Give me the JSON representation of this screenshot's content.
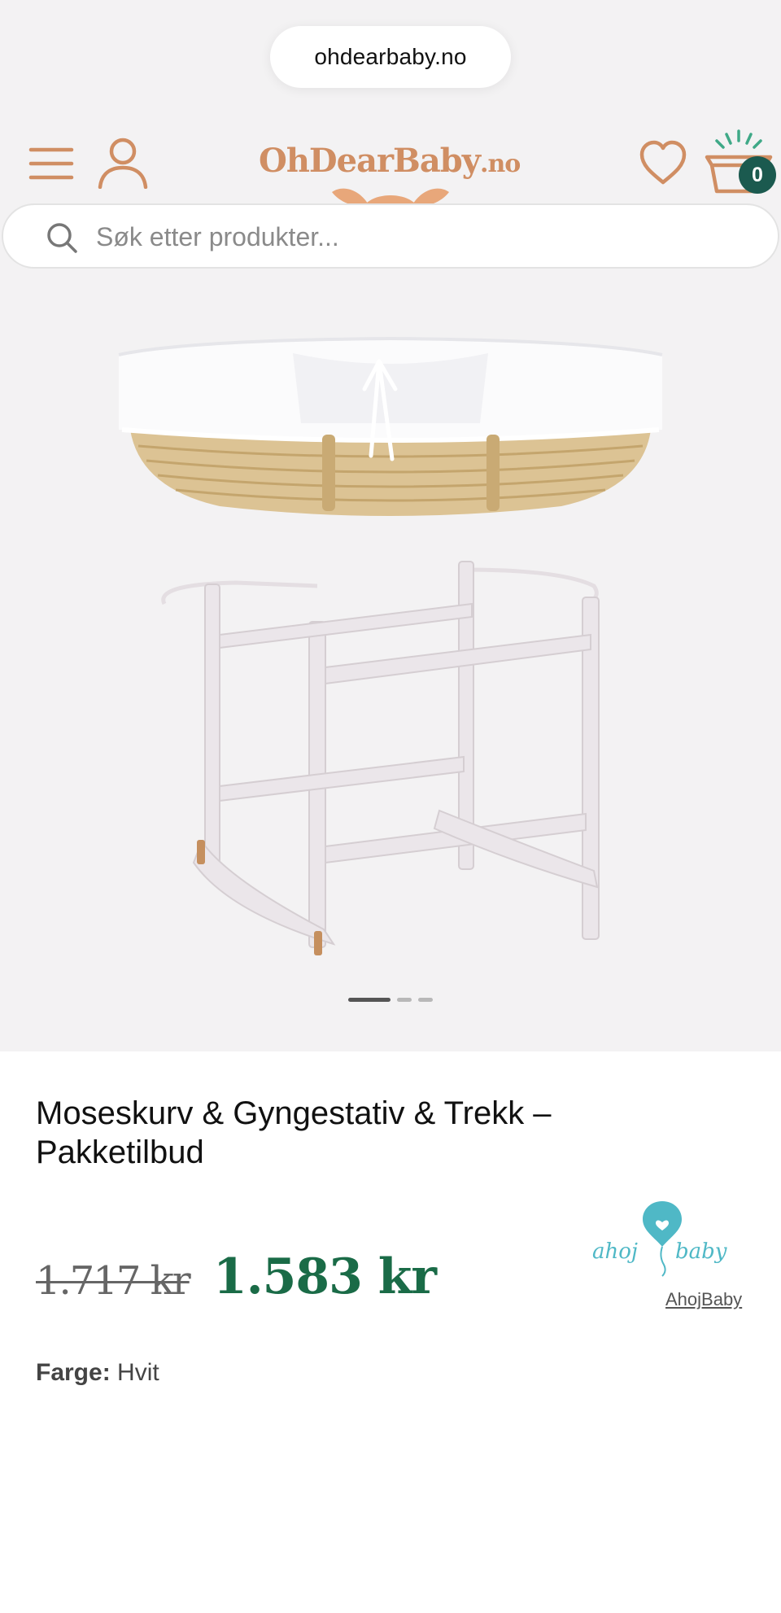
{
  "browser": {
    "url": "ohdearbaby.no"
  },
  "header": {
    "logo_main": "OhDearBaby",
    "logo_suffix": ".no",
    "cart_count": "0",
    "icons": {
      "menu": "hamburger-menu-icon",
      "account": "user-icon",
      "wishlist": "heart-icon",
      "cart": "basket-icon"
    }
  },
  "search": {
    "placeholder": "Søk etter produkter..."
  },
  "gallery": {
    "slides": 3,
    "active_slide": 1
  },
  "product": {
    "title": "Moseskurv & Gyngestativ & Trekk – Pakketilbud",
    "old_price": "1.717 kr",
    "price": "1.583 kr",
    "brand": {
      "name": "AhojBaby",
      "logo_left": "ahoj",
      "logo_right": "baby"
    },
    "color": {
      "label": "Farge:",
      "value": "Hvit"
    }
  },
  "colors": {
    "brand_orange": "#d08e63",
    "price_green": "#1a6b47",
    "badge_green": "#1b5a4f",
    "brand_teal": "#4fb8c6"
  }
}
